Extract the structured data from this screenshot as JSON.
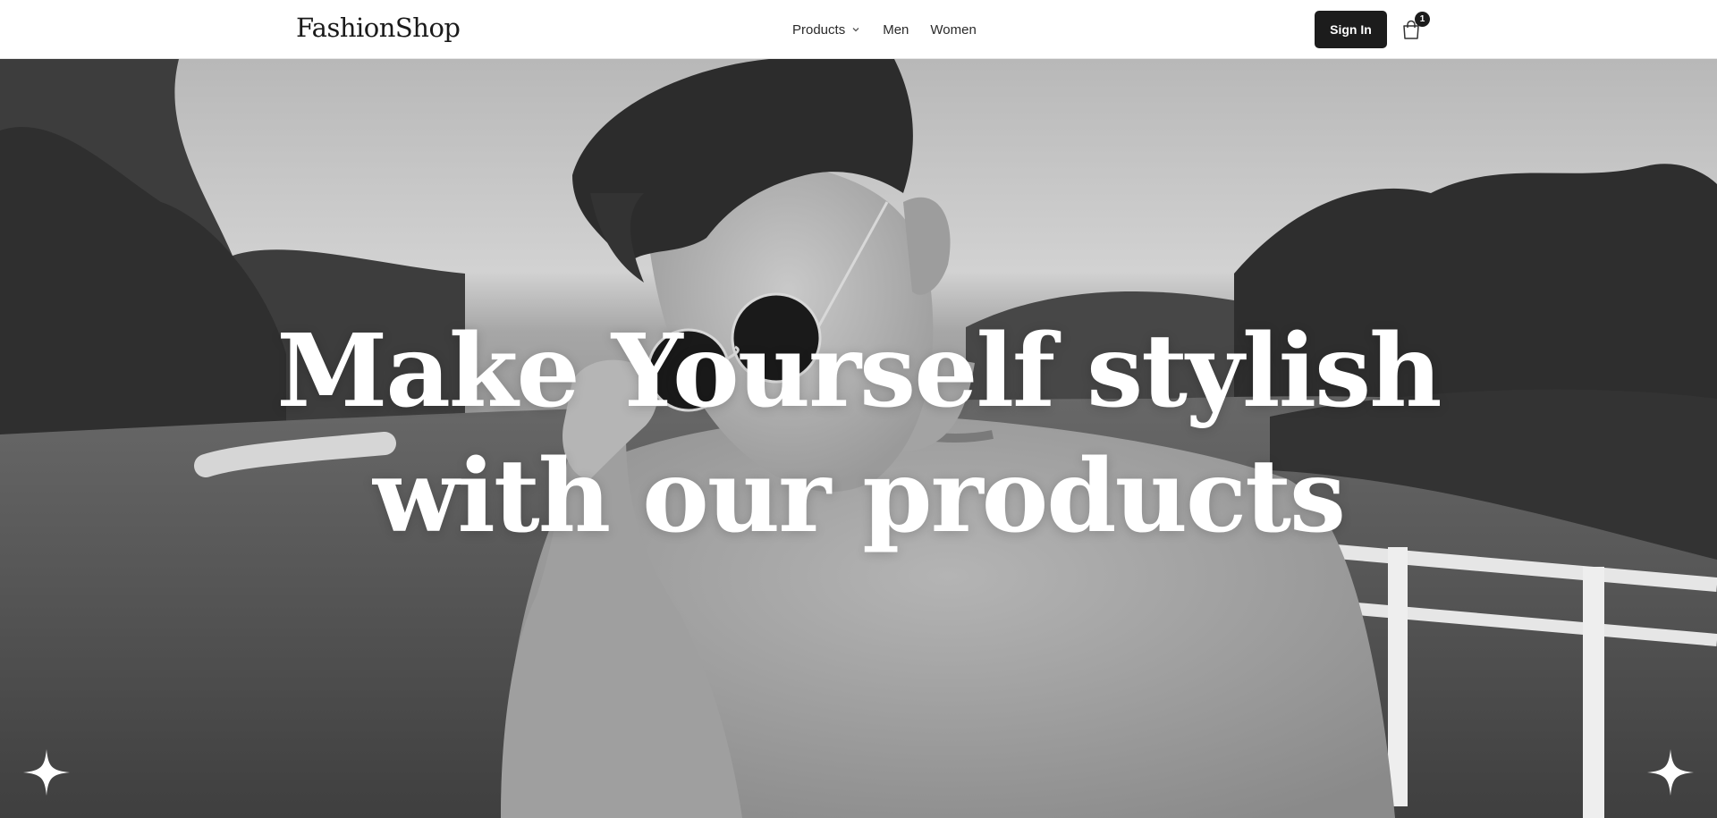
{
  "header": {
    "logo": "FashionShop",
    "nav": [
      {
        "label": "Products",
        "has_dropdown": true,
        "icon": "chevron-down-icon"
      },
      {
        "label": "Men"
      },
      {
        "label": "Women"
      }
    ],
    "sign_in_label": "Sign In",
    "cart": {
      "icon": "shopping-bag-icon",
      "count": "1"
    }
  },
  "hero": {
    "headline_line1": "Make Yourself stylish",
    "headline_line2": "with our products",
    "decorations": [
      "sparkle-icon",
      "sparkle-icon"
    ]
  },
  "colors": {
    "button_bg": "#1c1c1c",
    "text_dark": "#1a1a1a",
    "headline": "#ffffff"
  }
}
